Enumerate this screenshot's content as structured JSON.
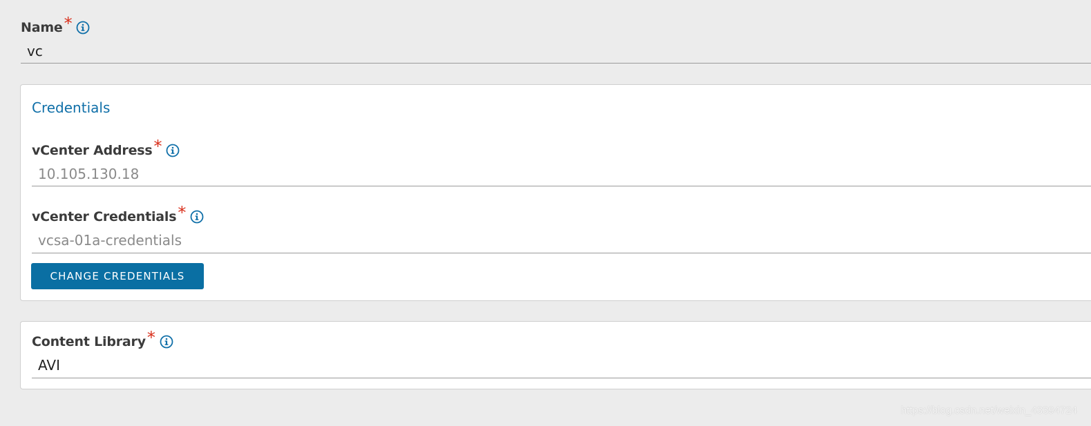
{
  "name_field": {
    "label": "Name",
    "required_mark": "*",
    "value": "vc",
    "info_icon": "info-circle-icon"
  },
  "credentials": {
    "title": "Credentials",
    "vcenter_address": {
      "label": "vCenter Address",
      "required_mark": "*",
      "value": "10.105.130.18",
      "info_icon": "info-circle-icon"
    },
    "vcenter_credentials": {
      "label": "vCenter Credentials",
      "required_mark": "*",
      "value": "vcsa-01a-credentials",
      "info_icon": "info-circle-icon"
    },
    "change_button_label": "CHANGE CREDENTIALS"
  },
  "content_library": {
    "label": "Content Library",
    "required_mark": "*",
    "value": "AVI",
    "info_icon": "info-circle-icon"
  },
  "watermark": "https://blog.csdn.net/weixin_43394724",
  "colors": {
    "accent": "#0a6fa3",
    "required": "#d9301c",
    "background": "#ececec",
    "card": "#ffffff"
  }
}
